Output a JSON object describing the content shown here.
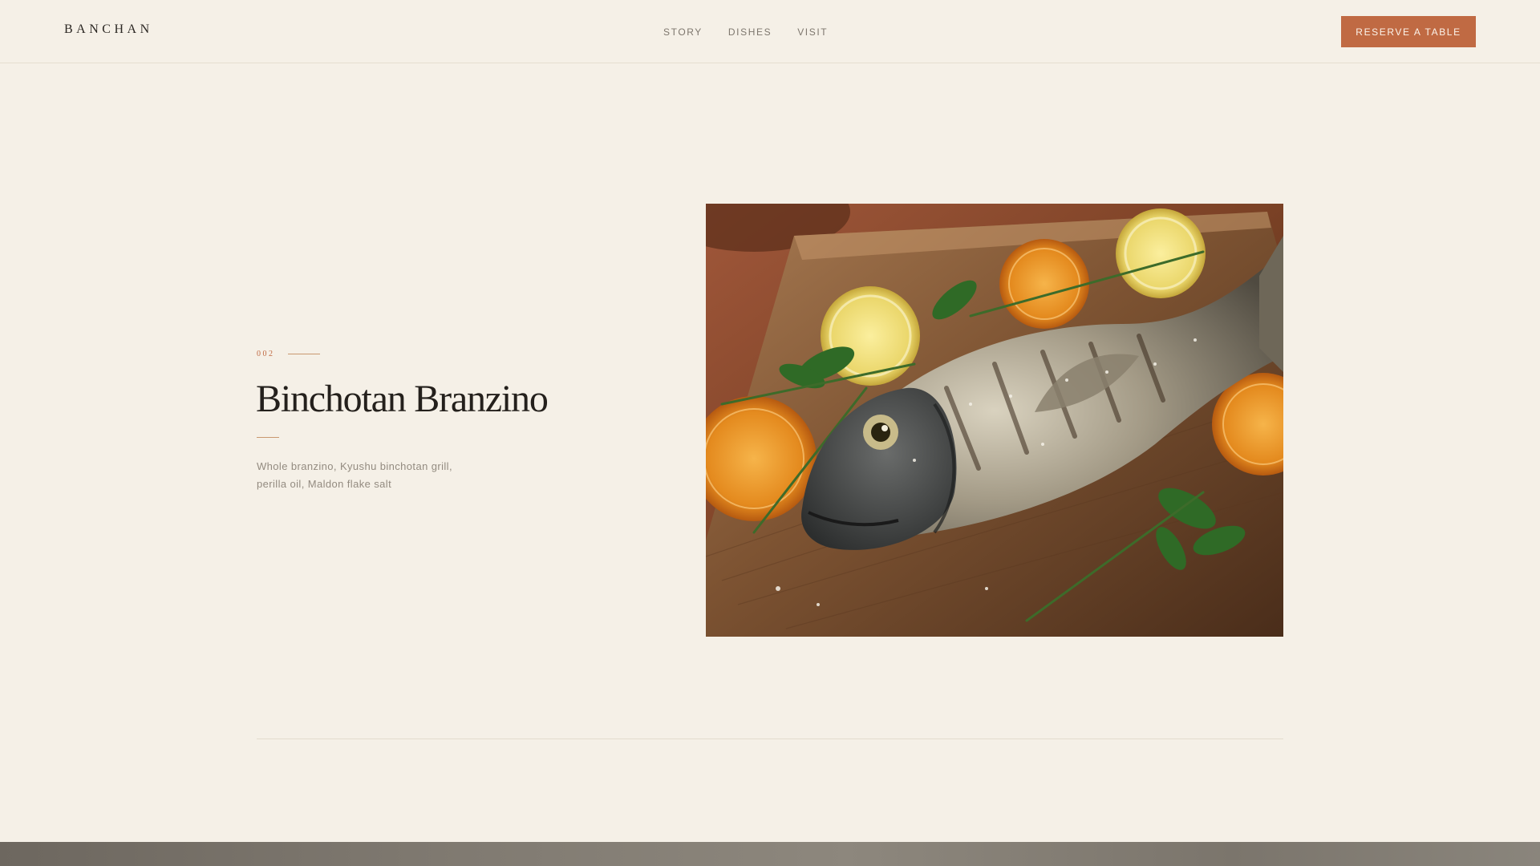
{
  "header": {
    "logo": "BANCHAN",
    "nav": [
      {
        "label": "STORY"
      },
      {
        "label": "DISHES"
      },
      {
        "label": "VISIT"
      }
    ],
    "cta_label": "RESERVE A TABLE"
  },
  "dish": {
    "number": "002",
    "title": "Binchotan Branzino",
    "description_lines": [
      "Whole branzino, Kyushu binchotan grill,",
      "perilla oil, Maldon flake salt"
    ],
    "photo_icon": "grilled-fish-photo"
  },
  "colors": {
    "background": "#f5f0e7",
    "accent": "#c06a43",
    "heading": "#24201c",
    "muted_text": "#938b80"
  }
}
